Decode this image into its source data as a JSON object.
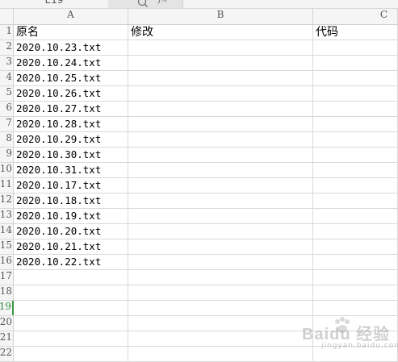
{
  "formula_bar": {
    "name_box": "E19",
    "fx_label": "fx"
  },
  "columns": [
    "A",
    "B",
    "C"
  ],
  "rows": [
    {
      "num": "1",
      "a": "原名",
      "b": "修改",
      "c": "代码"
    },
    {
      "num": "2",
      "a": "2020.10.23.txt",
      "b": "",
      "c": ""
    },
    {
      "num": "3",
      "a": "2020.10.24.txt",
      "b": "",
      "c": ""
    },
    {
      "num": "4",
      "a": "2020.10.25.txt",
      "b": "",
      "c": ""
    },
    {
      "num": "5",
      "a": "2020.10.26.txt",
      "b": "",
      "c": ""
    },
    {
      "num": "6",
      "a": "2020.10.27.txt",
      "b": "",
      "c": ""
    },
    {
      "num": "7",
      "a": "2020.10.28.txt",
      "b": "",
      "c": ""
    },
    {
      "num": "8",
      "a": "2020.10.29.txt",
      "b": "",
      "c": ""
    },
    {
      "num": "9",
      "a": "2020.10.30.txt",
      "b": "",
      "c": ""
    },
    {
      "num": "10",
      "a": "2020.10.31.txt",
      "b": "",
      "c": ""
    },
    {
      "num": "11",
      "a": "2020.10.17.txt",
      "b": "",
      "c": ""
    },
    {
      "num": "12",
      "a": "2020.10.18.txt",
      "b": "",
      "c": ""
    },
    {
      "num": "13",
      "a": "2020.10.19.txt",
      "b": "",
      "c": ""
    },
    {
      "num": "14",
      "a": "2020.10.20.txt",
      "b": "",
      "c": ""
    },
    {
      "num": "15",
      "a": "2020.10.21.txt",
      "b": "",
      "c": ""
    },
    {
      "num": "16",
      "a": "2020.10.22.txt",
      "b": "",
      "c": ""
    },
    {
      "num": "17",
      "a": "",
      "b": "",
      "c": ""
    },
    {
      "num": "18",
      "a": "",
      "b": "",
      "c": ""
    },
    {
      "num": "19",
      "a": "",
      "b": "",
      "c": ""
    },
    {
      "num": "20",
      "a": "",
      "b": "",
      "c": ""
    },
    {
      "num": "21",
      "a": "",
      "b": "",
      "c": ""
    },
    {
      "num": "22",
      "a": "",
      "b": "",
      "c": ""
    }
  ],
  "active_row": "19",
  "watermark": {
    "text": "Baidu 经验",
    "sub": "jingyan.baidu.com"
  }
}
